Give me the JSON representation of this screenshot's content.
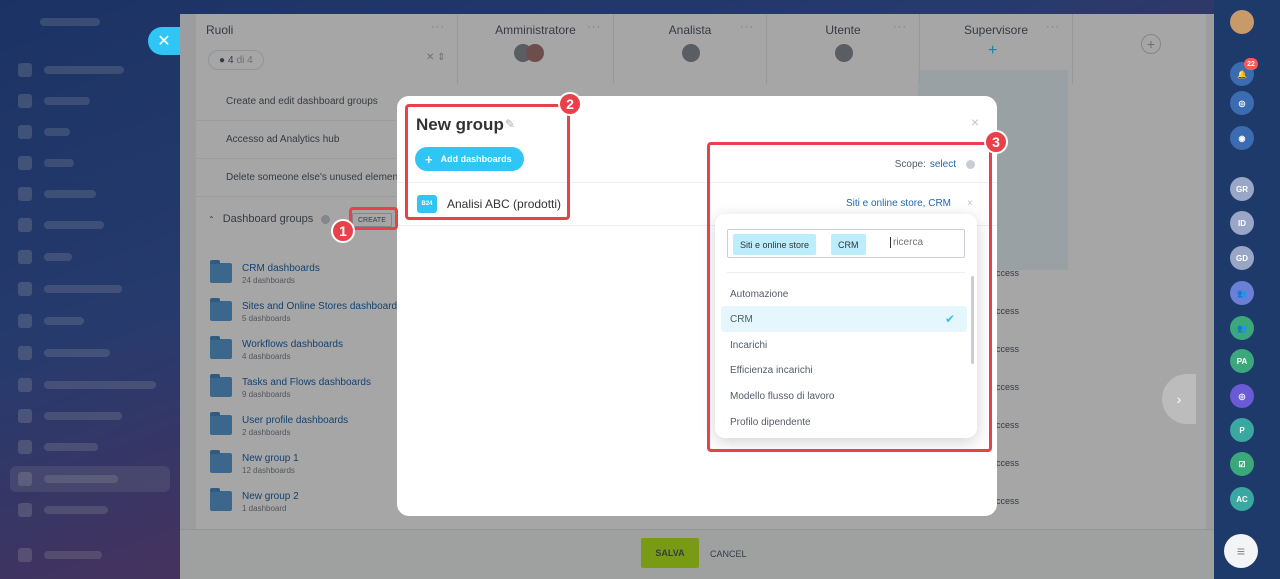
{
  "roles_table": {
    "roles_label": "Ruoli",
    "counter_value": "4",
    "counter_suffix": "di 4",
    "columns": [
      "Amministratore",
      "Analista",
      "Utente",
      "Supervisore"
    ],
    "permission_rows": [
      "Create and edit dashboard groups",
      "Accesso ad Analytics hub",
      "Delete someone else's unused elements"
    ],
    "dashboard_groups_label": "Dashboard groups",
    "create_label": "CREATE",
    "groups": [
      {
        "title": "CRM dashboards",
        "subtitle": "24 dashboards"
      },
      {
        "title": "Sites and Online Stores dashboards",
        "subtitle": "5 dashboards"
      },
      {
        "title": "Workflows dashboards",
        "subtitle": "4 dashboards"
      },
      {
        "title": "Tasks and Flows dashboards",
        "subtitle": "9 dashboards"
      },
      {
        "title": "User profile dashboards",
        "subtitle": "2 dashboards"
      },
      {
        "title": "New group 1",
        "subtitle": "12 dashboards"
      },
      {
        "title": "New group 2",
        "subtitle": "1 dashboard"
      }
    ],
    "access_text": "ccess"
  },
  "modal": {
    "title": "New group",
    "add_button": "Add dashboards",
    "scope_label": "Scope:",
    "scope_link": "select",
    "dashboard_icon": "B24",
    "dashboard_name": "Analisi ABC (prodotti)",
    "dashboard_scope": "Siti e online store, CRM",
    "close_glyph": "×"
  },
  "scope_dropdown": {
    "tags": [
      "Siti e online store",
      "CRM"
    ],
    "search_placeholder": "ricerca",
    "items": [
      {
        "label": "Automazione",
        "selected": false
      },
      {
        "label": "CRM",
        "selected": true
      },
      {
        "label": "Incarichi",
        "selected": false
      },
      {
        "label": "Efficienza incarichi",
        "selected": false
      },
      {
        "label": "Modello flusso di lavoro",
        "selected": false
      },
      {
        "label": "Profilo dipendente",
        "selected": false
      }
    ]
  },
  "footer": {
    "save": "SALVA",
    "cancel": "CANCEL"
  },
  "right_rail": {
    "notification_count": "22",
    "avatars": [
      "GR",
      "ID",
      "GD",
      "PA",
      "P",
      "AC"
    ]
  },
  "annotations": [
    "1",
    "2",
    "3"
  ],
  "colors": {
    "accent": "#2fc6f6",
    "save": "#bbed21",
    "annotation": "#e8414a",
    "link": "#2067b0"
  }
}
